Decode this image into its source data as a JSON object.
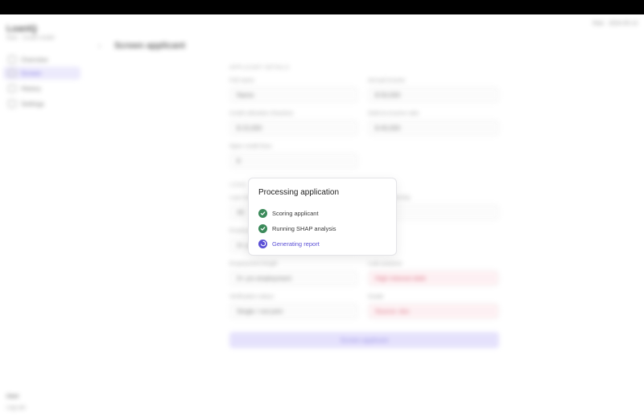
{
  "app": {
    "brand": "LoanIQ",
    "brand_sub": "Risk · Credit model",
    "top_right": "Risk · 2024-05-14"
  },
  "sidebar": {
    "items": [
      {
        "label": "Overview"
      },
      {
        "label": "Screen"
      },
      {
        "label": "History"
      },
      {
        "label": "Settings"
      }
    ],
    "user_label": "User",
    "logout_label": "Log out"
  },
  "main": {
    "back": "‹",
    "title": "Screen applicant",
    "section1": "APPLICANT DETAILS",
    "section2": "LOAN",
    "fields": [
      {
        "label": "Full name",
        "value": "Name"
      },
      {
        "label": "Annual income",
        "value": "$ 50,000"
      },
      {
        "label": "Credit utilization (fraction)",
        "value": "$ 15,000"
      },
      {
        "label": "Debt-to-income ratio",
        "value": "$ 40,000"
      },
      {
        "label": "Open credit lines",
        "value": "8"
      },
      {
        "label": "Loan term",
        "value": "36"
      },
      {
        "label": "Home ownership",
        "value": "Rent"
      },
      {
        "label": "Employment length",
        "value": "3+ yrs employment"
      },
      {
        "label": "Loan purpose",
        "value": "High interest debt"
      },
      {
        "label": "Verification status",
        "value": "Single / not joint"
      },
      {
        "label": "Grade",
        "value": "Source: doc"
      }
    ],
    "submit": "Screen applicant",
    "footer": [
      "",
      "",
      "",
      ""
    ]
  },
  "modal": {
    "title": "Processing application",
    "steps": [
      {
        "label": "Scoring applicant",
        "status": "done"
      },
      {
        "label": "Running SHAP analysis",
        "status": "done"
      },
      {
        "label": "Generating report",
        "status": "running"
      }
    ]
  },
  "colors": {
    "accent": "#5a4fd6",
    "done": "#3b8a5a",
    "pink": "#d14b62"
  }
}
